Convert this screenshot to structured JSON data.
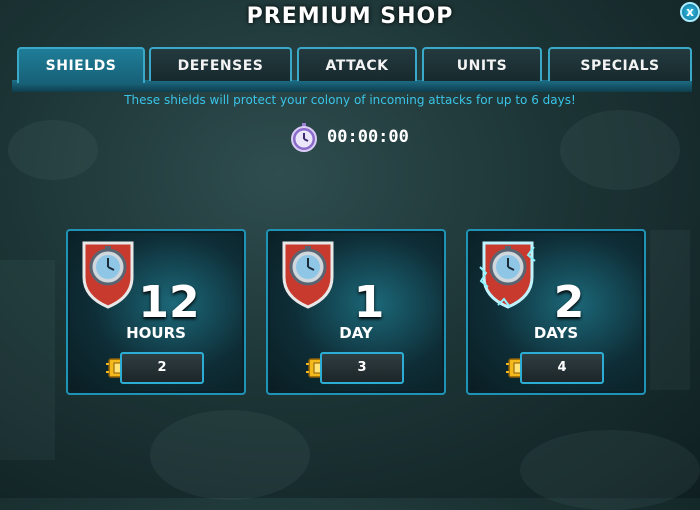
{
  "header": {
    "title": "PREMIUM SHOP",
    "close_label": "x"
  },
  "tabs": [
    {
      "label": "SHIELDS",
      "active": true
    },
    {
      "label": "DEFENSES",
      "active": false
    },
    {
      "label": "ATTACK",
      "active": false
    },
    {
      "label": "UNITS",
      "active": false
    },
    {
      "label": "SPECIALS",
      "active": false
    }
  ],
  "subtitle": "These shields will protect your colony of incoming attacks for up to 6 days!",
  "timer": {
    "icon": "stopwatch-icon",
    "value": "00:00:00"
  },
  "shields": [
    {
      "amount": "12",
      "unit": "HOURS",
      "price": "2",
      "icon": "shield-stopwatch-icon"
    },
    {
      "amount": "1",
      "unit": "DAY",
      "price": "3",
      "icon": "shield-stopwatch-icon"
    },
    {
      "amount": "2",
      "unit": "DAYS",
      "price": "4",
      "icon": "shield-stopwatch-electric-icon"
    }
  ],
  "colors": {
    "accent": "#39c4e8",
    "tab_active": "#1f7d98",
    "card_border": "#1f93b6",
    "coin": "#f2b81c"
  }
}
